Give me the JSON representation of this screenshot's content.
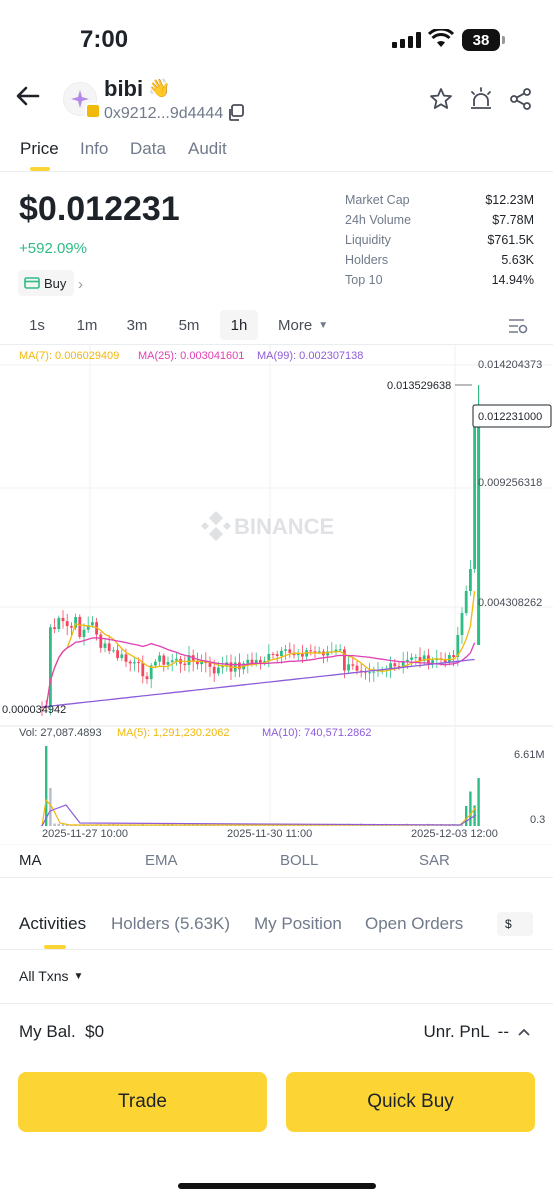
{
  "status": {
    "time": "7:00",
    "battery": "38"
  },
  "token": {
    "name": "bibi",
    "emoji": "👋",
    "address": "0x9212...9d4444"
  },
  "tabs": [
    "Price",
    "Info",
    "Data",
    "Audit"
  ],
  "price": {
    "value": "$0.012231",
    "change": "+592.09%",
    "buy_label": "Buy"
  },
  "stats": [
    {
      "label": "Market Cap",
      "value": "$12.23M"
    },
    {
      "label": "24h Volume",
      "value": "$7.78M"
    },
    {
      "label": "Liquidity",
      "value": "$761.5K"
    },
    {
      "label": "Holders",
      "value": "5.63K"
    },
    {
      "label": "Top 10",
      "value": "14.94%"
    }
  ],
  "timeframes": [
    "1s",
    "1m",
    "3m",
    "5m",
    "1h",
    "More"
  ],
  "active_timeframe": "1h",
  "chart": {
    "ma_legend": [
      "MA(7): 0.006029409",
      "MA(25): 0.003041601",
      "MA(99): 0.002307138"
    ],
    "watermark": "BINANCE",
    "price_axis": [
      "0.014204373",
      "0.009256318",
      "0.004308262"
    ],
    "high_label": "0.013529638",
    "low_label": "0.000034942",
    "current_label": "0.012231000",
    "vol_legend": [
      "Vol: 27,087.4893",
      "MA(5): 1,291,230.2062",
      "MA(10): 740,571.2862"
    ],
    "vol_axis": [
      "6.61M",
      "0.3"
    ],
    "x_axis": [
      "2025-11-27 10:00",
      "2025-11-30 11:00",
      "2025-12-03 12:00"
    ]
  },
  "colors": {
    "up": "#2ebd85",
    "down": "#f6465d",
    "ma7": "#f0b90b",
    "ma25": "#e040b5",
    "ma99": "#8e5cd9",
    "accent": "#fcd535"
  },
  "indicators": [
    "MA",
    "EMA",
    "BOLL",
    "SAR"
  ],
  "activity_tabs": [
    "Activities",
    "Holders (5.63K)",
    "My Position",
    "Open Orders"
  ],
  "currency_chip": "$",
  "filter": "All Txns",
  "balance": {
    "label": "My Bal.",
    "value": "$0"
  },
  "pnl": {
    "label": "Unr. PnL",
    "value": "--"
  },
  "buttons": {
    "trade": "Trade",
    "quick_buy": "Quick Buy"
  }
}
